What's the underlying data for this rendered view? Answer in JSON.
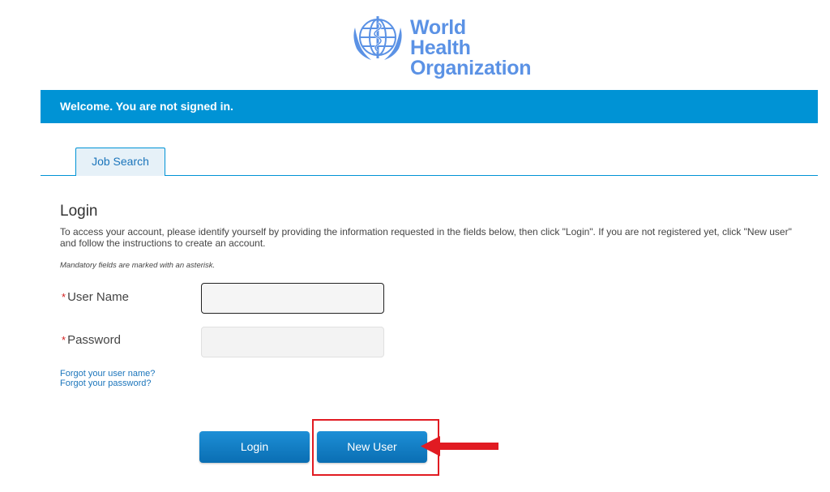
{
  "header": {
    "logo": {
      "line1": "World Health",
      "line2": "Organization",
      "icon": "who-emblem-icon",
      "color": "#5b92e5"
    }
  },
  "welcome_bar": {
    "text": "Welcome. You are not signed in.",
    "color": "#0093d5"
  },
  "tabs": [
    {
      "label": "Job Search",
      "active": true
    }
  ],
  "login": {
    "title": "Login",
    "intro": "To access your account, please identify yourself by providing the information requested in the fields below, then click \"Login\". If you are not registered yet, click \"New user\" and follow the instructions to create an account.",
    "mandatory_note": "Mandatory fields are marked with an asterisk.",
    "fields": {
      "username": {
        "label": "User Name",
        "value": "",
        "required_marker": "*"
      },
      "password": {
        "label": "Password",
        "value": "",
        "required_marker": "*"
      }
    },
    "links": {
      "forgot_username": "Forgot your user name?",
      "forgot_password": "Forgot your password?"
    },
    "buttons": {
      "login": "Login",
      "new_user": "New User"
    }
  },
  "annotation": {
    "highlight_color": "#e11b22",
    "arrow_icon": "arrow-left-icon"
  }
}
